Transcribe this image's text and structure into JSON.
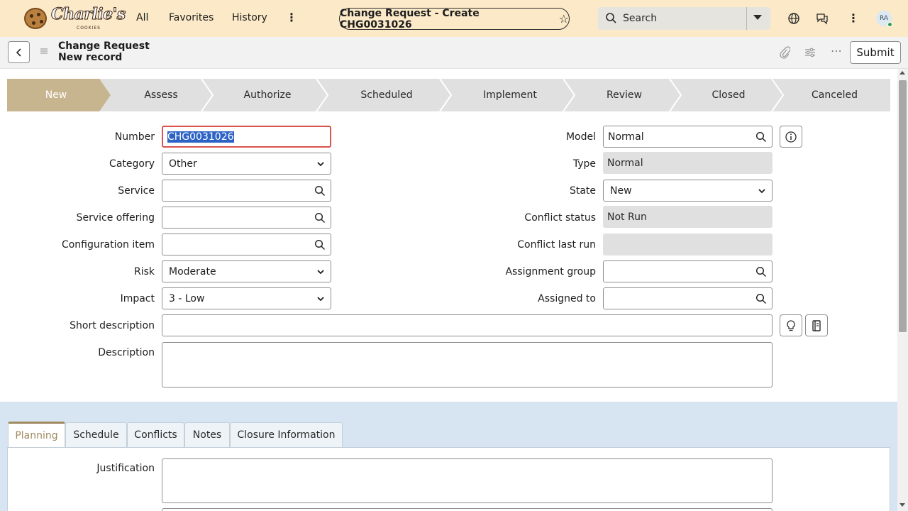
{
  "app": {
    "brand": "Charlie's",
    "brand_sub": "COOKIES",
    "nav": [
      "All",
      "Favorites",
      "History"
    ],
    "record_tab_title": "Change Request - Create CHG0031026",
    "search_placeholder": "Search",
    "user_initials": "RA"
  },
  "header": {
    "title_line1": "Change Request",
    "title_line2": "New record",
    "submit_label": "Submit"
  },
  "flow": {
    "steps": [
      "New",
      "Assess",
      "Authorize",
      "Scheduled",
      "Implement",
      "Review",
      "Closed",
      "Canceled"
    ],
    "active": "New"
  },
  "form": {
    "number": {
      "label": "Number",
      "value": "CHG0031026"
    },
    "category": {
      "label": "Category",
      "value": "Other"
    },
    "service": {
      "label": "Service",
      "value": ""
    },
    "service_offering": {
      "label": "Service offering",
      "value": ""
    },
    "configuration_item": {
      "label": "Configuration item",
      "value": ""
    },
    "risk": {
      "label": "Risk",
      "value": "Moderate"
    },
    "impact": {
      "label": "Impact",
      "value": "3 - Low"
    },
    "short_description": {
      "label": "Short description",
      "value": ""
    },
    "description": {
      "label": "Description",
      "value": ""
    },
    "model": {
      "label": "Model",
      "value": "Normal"
    },
    "type": {
      "label": "Type",
      "value": "Normal"
    },
    "state": {
      "label": "State",
      "value": "New"
    },
    "conflict_status": {
      "label": "Conflict status",
      "value": "Not Run"
    },
    "conflict_last_run": {
      "label": "Conflict last run",
      "value": ""
    },
    "assignment_group": {
      "label": "Assignment group",
      "value": ""
    },
    "assigned_to": {
      "label": "Assigned to",
      "value": ""
    }
  },
  "tabs": {
    "items": [
      "Planning",
      "Schedule",
      "Conflicts",
      "Notes",
      "Closure Information"
    ],
    "active": "Planning"
  },
  "planning": {
    "justification_label": "Justification"
  },
  "colors": {
    "banner": "#fbe9c8",
    "flow_active": "#c7b58f",
    "tab_accent": "#a08a5e",
    "tabs_background": "#d6e5f1"
  }
}
